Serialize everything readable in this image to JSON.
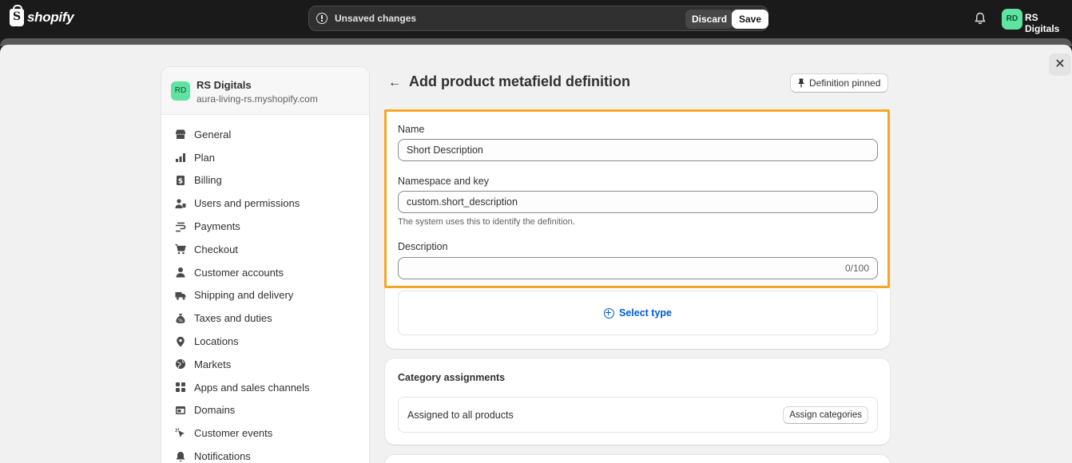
{
  "topbar": {
    "logo_text": "shopify",
    "logo_mark": "S",
    "unsaved_text": "Unsaved changes",
    "discard_label": "Discard",
    "save_label": "Save",
    "avatar_initials": "RD",
    "store_name": "RS Digitals"
  },
  "sidebar": {
    "store_initials": "RD",
    "store_name": "RS Digitals",
    "store_domain": "aura-living-rs.myshopify.com",
    "items": [
      {
        "label": "General",
        "icon": "store-icon"
      },
      {
        "label": "Plan",
        "icon": "plan-icon"
      },
      {
        "label": "Billing",
        "icon": "billing-icon"
      },
      {
        "label": "Users and permissions",
        "icon": "users-icon"
      },
      {
        "label": "Payments",
        "icon": "payments-icon"
      },
      {
        "label": "Checkout",
        "icon": "cart-icon"
      },
      {
        "label": "Customer accounts",
        "icon": "person-icon"
      },
      {
        "label": "Shipping and delivery",
        "icon": "truck-icon"
      },
      {
        "label": "Taxes and duties",
        "icon": "tax-icon"
      },
      {
        "label": "Locations",
        "icon": "location-icon"
      },
      {
        "label": "Markets",
        "icon": "globe-icon"
      },
      {
        "label": "Apps and sales channels",
        "icon": "apps-icon"
      },
      {
        "label": "Domains",
        "icon": "domain-icon"
      },
      {
        "label": "Customer events",
        "icon": "cursor-icon"
      },
      {
        "label": "Notifications",
        "icon": "bell-icon"
      }
    ]
  },
  "main": {
    "title": "Add product metafield definition",
    "pinned_label": "Definition pinned",
    "name_label": "Name",
    "name_value": "Short Description",
    "ns_label": "Namespace and key",
    "ns_value": "custom.short_description",
    "ns_help": "The system uses this to identify the definition.",
    "desc_label": "Description",
    "desc_value": "",
    "desc_counter": "0/100",
    "select_type_label": "Select type",
    "category_title": "Category assignments",
    "assigned_text": "Assigned to all products",
    "assign_button": "Assign categories"
  },
  "colors": {
    "highlight": "#f5a623",
    "link": "#005bd3",
    "avatar": "#5fe3a1"
  }
}
